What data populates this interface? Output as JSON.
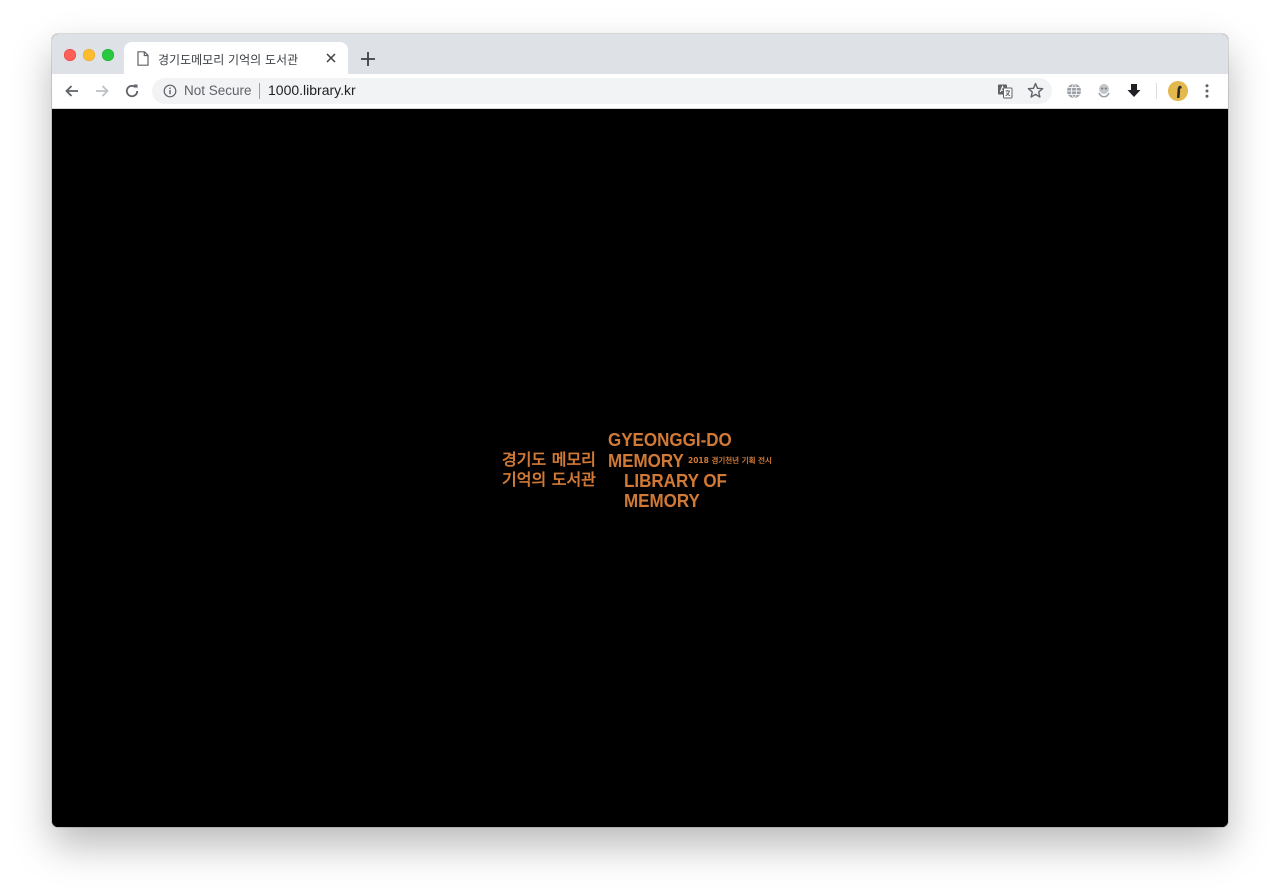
{
  "browser": {
    "tab": {
      "title": "경기도메모리 기억의 도서관"
    },
    "address_bar": {
      "security_label": "Not Secure",
      "url": "1000.library.kr"
    }
  },
  "page": {
    "logo": {
      "title_en_line1": "GYEONGGI-DO",
      "title_en_line2": "MEMORY",
      "title_ko_line1": "경기도 메모리",
      "title_ko_line2": "기억의 도서관",
      "subtitle": "2018 경기천년 기획 전시",
      "library_line1": "LIBRARY OF",
      "library_line2": "MEMORY"
    }
  },
  "colors": {
    "logo_orange": "#d27a35",
    "page_background": "#000000",
    "tab_strip": "#dee1e6"
  },
  "icons": {
    "toolbar": [
      "back-icon",
      "forward-icon",
      "reload-icon",
      "info-icon",
      "translate-icon",
      "star-icon",
      "globe-extension-icon",
      "extension-icon",
      "download-extension-icon",
      "avatar",
      "menu-icon"
    ]
  }
}
